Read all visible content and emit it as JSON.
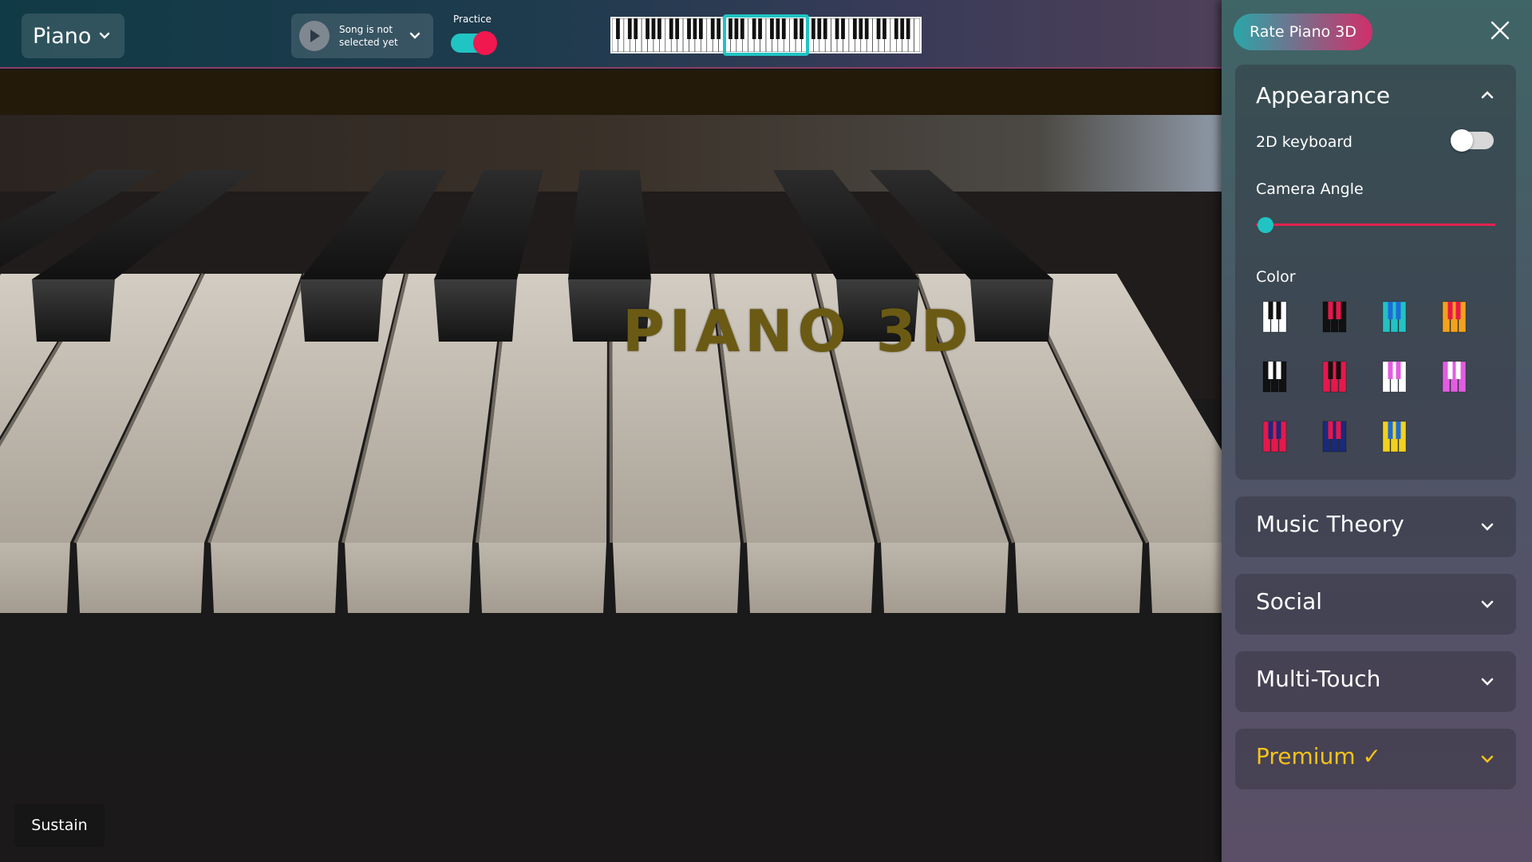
{
  "topbar": {
    "instrument_label": "Piano",
    "song_label": "Song is not selected yet",
    "practice_label": "Practice",
    "practice_on": true
  },
  "scene": {
    "brand": "PIANO 3D",
    "sustain_label": "Sustain"
  },
  "panel": {
    "rate_label": "Rate Piano 3D",
    "appearance": {
      "title": "Appearance",
      "keyboard2d_label": "2D keyboard",
      "keyboard2d_on": false,
      "camera_label": "Camera Angle",
      "camera_value": 0,
      "color_label": "Color",
      "swatches": [
        {
          "name": "white-black",
          "white": "#ffffff",
          "black": "#111111"
        },
        {
          "name": "black-red",
          "white": "#111111",
          "black": "#e8174c"
        },
        {
          "name": "teal-blue",
          "white": "#22c2c5",
          "black": "#1e6bd6"
        },
        {
          "name": "orange-red",
          "white": "#f3a21b",
          "black": "#e8174c"
        },
        {
          "name": "black-white",
          "white": "#111111",
          "black": "#ffffff"
        },
        {
          "name": "red-black",
          "white": "#e8174c",
          "black": "#111111"
        },
        {
          "name": "white-pink",
          "white": "#ffffff",
          "black": "#e25de0"
        },
        {
          "name": "pink-white",
          "white": "#e25de0",
          "black": "#ffffff"
        },
        {
          "name": "red-navy",
          "white": "#e8174c",
          "black": "#1a2a7a"
        },
        {
          "name": "navy-red",
          "white": "#1a2a7a",
          "black": "#e8174c"
        },
        {
          "name": "yellow-blue",
          "white": "#f2d21c",
          "black": "#1e6bd6"
        }
      ]
    },
    "sections": [
      {
        "id": "music-theory",
        "title": "Music Theory"
      },
      {
        "id": "social",
        "title": "Social"
      },
      {
        "id": "multi-touch",
        "title": "Multi-Touch"
      },
      {
        "id": "premium",
        "title": "Premium ✓"
      }
    ]
  },
  "colors": {
    "accent_teal": "#20c4c3",
    "accent_red": "#f0184f",
    "premium_gold": "#f4c21b"
  }
}
